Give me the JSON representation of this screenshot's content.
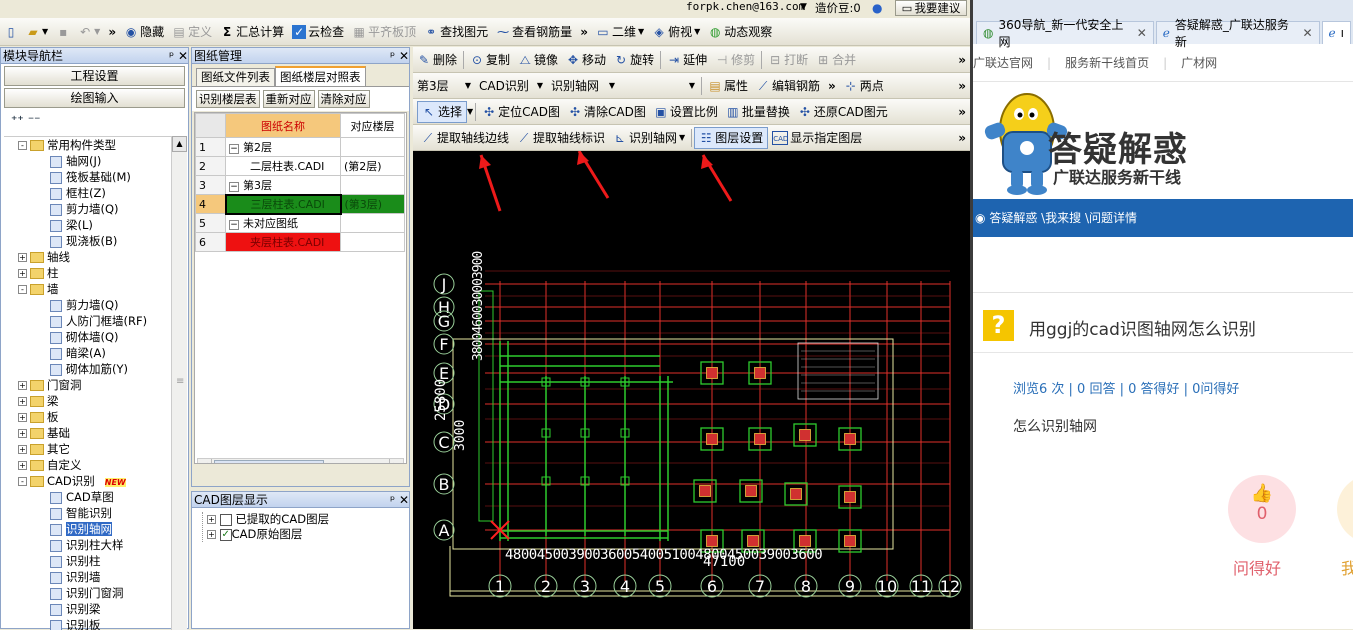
{
  "titlebar": {
    "email": "forpk.chen@163.com",
    "price_label": "造价豆:0",
    "suggest": "我要建议"
  },
  "toolbar1": {
    "hide": "隐藏",
    "define": "定义",
    "sum_calc": "汇总计算",
    "cloud_check": "云检查",
    "flat_board": "平齐板顶",
    "find_elem": "查找图元",
    "view_rebar": "查看钢筋量",
    "view2d": "二维",
    "top_view": "俯视",
    "dynamic": "动态观察"
  },
  "navigator": {
    "title": "模块导航栏",
    "proj_settings": "工程设置",
    "draw_input": "绘图输入",
    "tree": [
      {
        "label": "常用构件类型",
        "level": 1,
        "type": "folder",
        "exp": "-"
      },
      {
        "label": "轴网(J)",
        "level": 2,
        "type": "item"
      },
      {
        "label": "筏板基础(M)",
        "level": 2,
        "type": "item"
      },
      {
        "label": "框柱(Z)",
        "level": 2,
        "type": "item"
      },
      {
        "label": "剪力墙(Q)",
        "level": 2,
        "type": "item"
      },
      {
        "label": "梁(L)",
        "level": 2,
        "type": "item"
      },
      {
        "label": "现浇板(B)",
        "level": 2,
        "type": "item"
      },
      {
        "label": "轴线",
        "level": 1,
        "type": "folder",
        "exp": "+"
      },
      {
        "label": "柱",
        "level": 1,
        "type": "folder",
        "exp": "+"
      },
      {
        "label": "墙",
        "level": 1,
        "type": "folder",
        "exp": "-"
      },
      {
        "label": "剪力墙(Q)",
        "level": 2,
        "type": "item"
      },
      {
        "label": "人防门框墙(RF)",
        "level": 2,
        "type": "item"
      },
      {
        "label": "砌体墙(Q)",
        "level": 2,
        "type": "item"
      },
      {
        "label": "暗梁(A)",
        "level": 2,
        "type": "item"
      },
      {
        "label": "砌体加筋(Y)",
        "level": 2,
        "type": "item"
      },
      {
        "label": "门窗洞",
        "level": 1,
        "type": "folder",
        "exp": "+"
      },
      {
        "label": "梁",
        "level": 1,
        "type": "folder",
        "exp": "+"
      },
      {
        "label": "板",
        "level": 1,
        "type": "folder",
        "exp": "+"
      },
      {
        "label": "基础",
        "level": 1,
        "type": "folder",
        "exp": "+"
      },
      {
        "label": "其它",
        "level": 1,
        "type": "folder",
        "exp": "+"
      },
      {
        "label": "自定义",
        "level": 1,
        "type": "folder",
        "exp": "+"
      },
      {
        "label": "CAD识别",
        "level": 1,
        "type": "folder",
        "exp": "-",
        "badge": "NEW"
      },
      {
        "label": "CAD草图",
        "level": 2,
        "type": "item"
      },
      {
        "label": "智能识别",
        "level": 2,
        "type": "item"
      },
      {
        "label": "识别轴网",
        "level": 2,
        "type": "item",
        "selected": true
      },
      {
        "label": "识别柱大样",
        "level": 2,
        "type": "item"
      },
      {
        "label": "识别柱",
        "level": 2,
        "type": "item"
      },
      {
        "label": "识别墙",
        "level": 2,
        "type": "item"
      },
      {
        "label": "识别门窗洞",
        "level": 2,
        "type": "item"
      },
      {
        "label": "识别梁",
        "level": 2,
        "type": "item"
      },
      {
        "label": "识别板",
        "level": 2,
        "type": "item"
      }
    ]
  },
  "drawing_mgr": {
    "title": "图纸管理",
    "tab1": "图纸文件列表",
    "tab2": "图纸楼层对照表",
    "btn1": "识别楼层表",
    "btn2": "重新对应",
    "btn3": "清除对应",
    "col_name": "图纸名称",
    "col_floor": "对应楼层",
    "rows": [
      {
        "n": "1",
        "name": "第2层",
        "floor": "",
        "kind": "group"
      },
      {
        "n": "2",
        "name": "二层柱表.CADI",
        "floor": "(第2层)",
        "kind": "item"
      },
      {
        "n": "3",
        "name": "第3层",
        "floor": "",
        "kind": "group"
      },
      {
        "n": "4",
        "name": "三层柱表.CADI",
        "floor": "(第3层)",
        "kind": "green"
      },
      {
        "n": "5",
        "name": "未对应图纸",
        "floor": "",
        "kind": "group"
      },
      {
        "n": "6",
        "name": "夹层柱表.CADI",
        "floor": "",
        "kind": "red"
      }
    ]
  },
  "cad_layers": {
    "title": "CAD图层显示",
    "item1": "已提取的CAD图层",
    "item2": "CAD原始图层"
  },
  "edit_bar": {
    "delete": "删除",
    "copy": "复制",
    "mirror": "镜像",
    "move": "移动",
    "rotate": "旋转",
    "extend": "延伸",
    "trim": "修剪",
    "break": "打断",
    "merge": "合并"
  },
  "layer_bar": {
    "floor": "第3层",
    "cad_recog": "CAD识别",
    "recog_axis": "识别轴网",
    "props": "属性",
    "edit_rebar": "编辑钢筋",
    "two_point": "两点"
  },
  "cad_bar": {
    "select": "选择",
    "locate_cad": "定位CAD图",
    "clear_cad": "清除CAD图",
    "set_scale": "设置比例",
    "batch_replace": "批量替换",
    "restore_cad": "还原CAD图元"
  },
  "axis_bar": {
    "extract_edge": "提取轴线边线",
    "extract_mark": "提取轴线标识",
    "recog_axis": "识别轴网",
    "layer_set": "图层设置",
    "show_layer": "显示指定图层"
  },
  "cad_canvas": {
    "row_labels": [
      "J",
      "H",
      "G",
      "F",
      "E",
      "D",
      "C",
      "B",
      "A"
    ],
    "col_labels": [
      "1",
      "2",
      "3",
      "4",
      "5",
      "6",
      "7",
      "8",
      "9",
      "10",
      "11",
      "12"
    ],
    "bottom_dims": "4800450039003600540051004800450039003600",
    "total_dim": "47100",
    "left_total": "25800",
    "left_dims": "3000",
    "vert_dims": "3800460030003900"
  },
  "browser": {
    "tabs": [
      "360导航_新一代安全上网",
      "答疑解惑_广联达服务新",
      "ı"
    ],
    "nav_links": [
      "广联达官网",
      "服务新干线首页",
      "广材网"
    ],
    "logo_title": "答疑解惑",
    "logo_sub": "广联达服务新干线",
    "breadcrumb": "答疑解惑 \\我来搜 \\问题详情",
    "question": "用ggj的cad识图轴网怎么识别",
    "stats": "浏览6 次 | 0 回答 | 0 答得好 | 0问得好",
    "body": "怎么识别轴网",
    "like_count": "0",
    "like_label": "问得好",
    "partial": "我"
  }
}
